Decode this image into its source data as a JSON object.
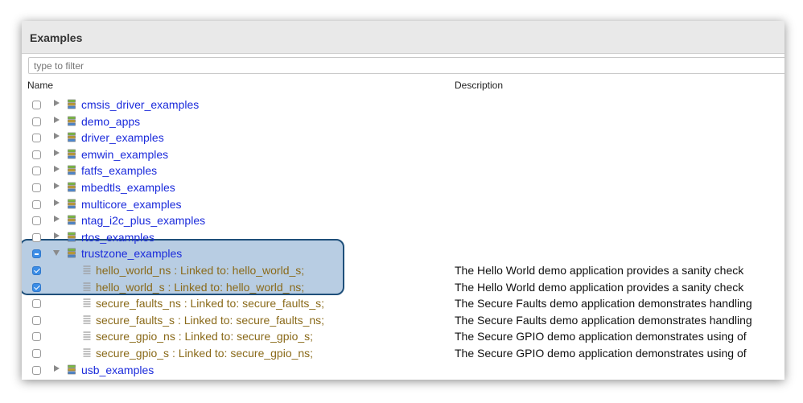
{
  "view": {
    "title": "Examples",
    "filter_placeholder": "type to filter",
    "columns": {
      "name": "Name",
      "description": "Description"
    }
  },
  "tree": {
    "items": [
      {
        "label": "cmsis_driver_examples",
        "type": "folder",
        "state": "unchecked",
        "expanded": false,
        "description": ""
      },
      {
        "label": "demo_apps",
        "type": "folder",
        "state": "unchecked",
        "expanded": false,
        "description": ""
      },
      {
        "label": "driver_examples",
        "type": "folder",
        "state": "unchecked",
        "expanded": false,
        "description": ""
      },
      {
        "label": "emwin_examples",
        "type": "folder",
        "state": "unchecked",
        "expanded": false,
        "description": ""
      },
      {
        "label": "fatfs_examples",
        "type": "folder",
        "state": "unchecked",
        "expanded": false,
        "description": ""
      },
      {
        "label": "mbedtls_examples",
        "type": "folder",
        "state": "unchecked",
        "expanded": false,
        "description": ""
      },
      {
        "label": "multicore_examples",
        "type": "folder",
        "state": "unchecked",
        "expanded": false,
        "description": ""
      },
      {
        "label": "ntag_i2c_plus_examples",
        "type": "folder",
        "state": "unchecked",
        "expanded": false,
        "description": ""
      },
      {
        "label": "rtos_examples",
        "type": "folder",
        "state": "unchecked",
        "expanded": false,
        "description": ""
      },
      {
        "label": "trustzone_examples",
        "type": "folder",
        "state": "mixed",
        "expanded": true,
        "description": ""
      },
      {
        "label": "hello_world_ns : Linked to: hello_world_s;",
        "type": "project",
        "state": "checked",
        "description": "The Hello World demo application provides a sanity check"
      },
      {
        "label": "hello_world_s : Linked to: hello_world_ns;",
        "type": "project",
        "state": "checked",
        "description": "The Hello World demo application provides a sanity check"
      },
      {
        "label": "secure_faults_ns : Linked to: secure_faults_s;",
        "type": "project",
        "state": "unchecked",
        "description": "The Secure Faults demo application demonstrates handling"
      },
      {
        "label": "secure_faults_s : Linked to: secure_faults_ns;",
        "type": "project",
        "state": "unchecked",
        "description": "The Secure Faults demo application demonstrates handling"
      },
      {
        "label": "secure_gpio_ns : Linked to: secure_gpio_s;",
        "type": "project",
        "state": "unchecked",
        "description": "The Secure GPIO demo application demonstrates using of"
      },
      {
        "label": "secure_gpio_s : Linked to: secure_gpio_ns;",
        "type": "project",
        "state": "unchecked",
        "description": "The Secure GPIO demo application demonstrates using of"
      },
      {
        "label": "usb_examples",
        "type": "folder",
        "state": "unchecked",
        "expanded": false,
        "description": ""
      }
    ]
  },
  "colors": {
    "folder_text": "#1b2bdb",
    "project_text": "#8a6a1a",
    "checkbox_checked": "#3c8de6",
    "highlight_border": "#1e4f7a"
  },
  "icons": {
    "folder": "library-stack-icon",
    "project": "document-lines-icon",
    "expand": "expand-triangle-icon"
  }
}
